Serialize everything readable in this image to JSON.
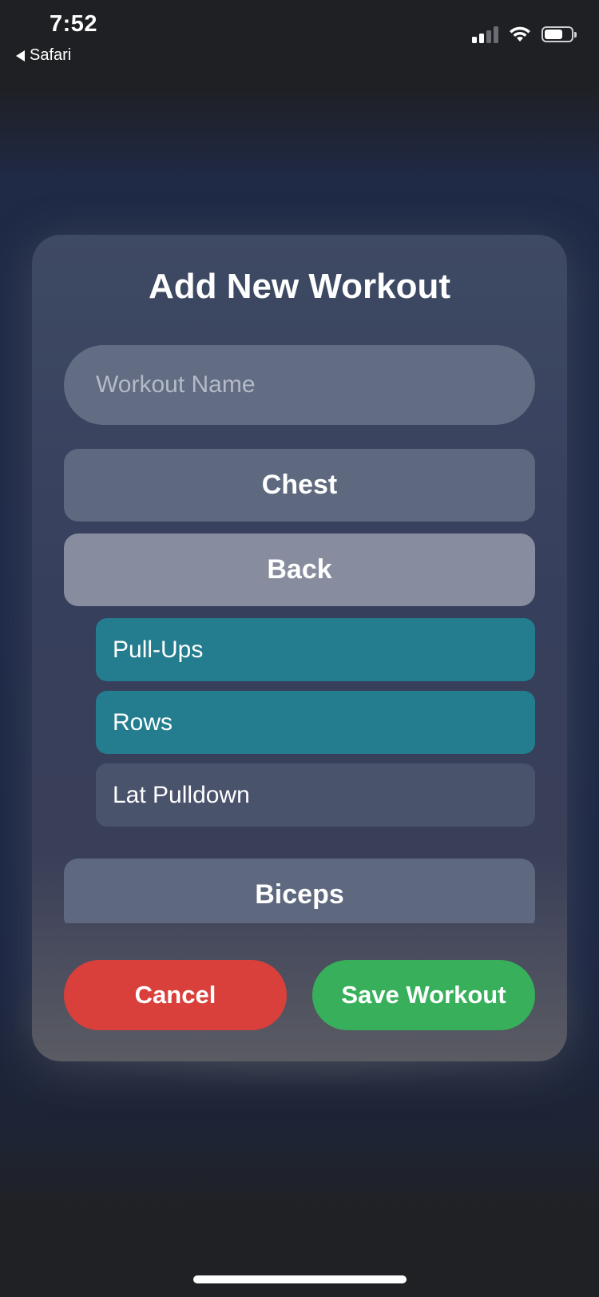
{
  "status_bar": {
    "time": "7:52",
    "back_app": "Safari",
    "back_icon": "back-triangle-icon",
    "signal_icon": "cellular-signal-icon",
    "signal_bars_filled": 2,
    "signal_bars_total": 4,
    "wifi_icon": "wifi-icon",
    "battery_icon": "battery-icon",
    "battery_level": 0.62
  },
  "modal": {
    "title": "Add New Workout",
    "name_input": {
      "placeholder": "Workout Name",
      "value": ""
    },
    "groups": [
      {
        "label": "Chest",
        "expanded": false
      },
      {
        "label": "Back",
        "expanded": true,
        "exercises": [
          {
            "label": "Pull-Ups",
            "selected": true
          },
          {
            "label": "Rows",
            "selected": true
          },
          {
            "label": "Lat Pulldown",
            "selected": false
          }
        ]
      },
      {
        "label": "Biceps",
        "expanded": false
      }
    ],
    "cancel_label": "Cancel",
    "save_label": "Save Workout"
  },
  "colors": {
    "cancel": "#d9403b",
    "save": "#38b05b",
    "selected_exercise": "#237d8e",
    "unselected_exercise": "#4a536c",
    "group_default": "#5e687e",
    "group_active": "#878d9e"
  }
}
